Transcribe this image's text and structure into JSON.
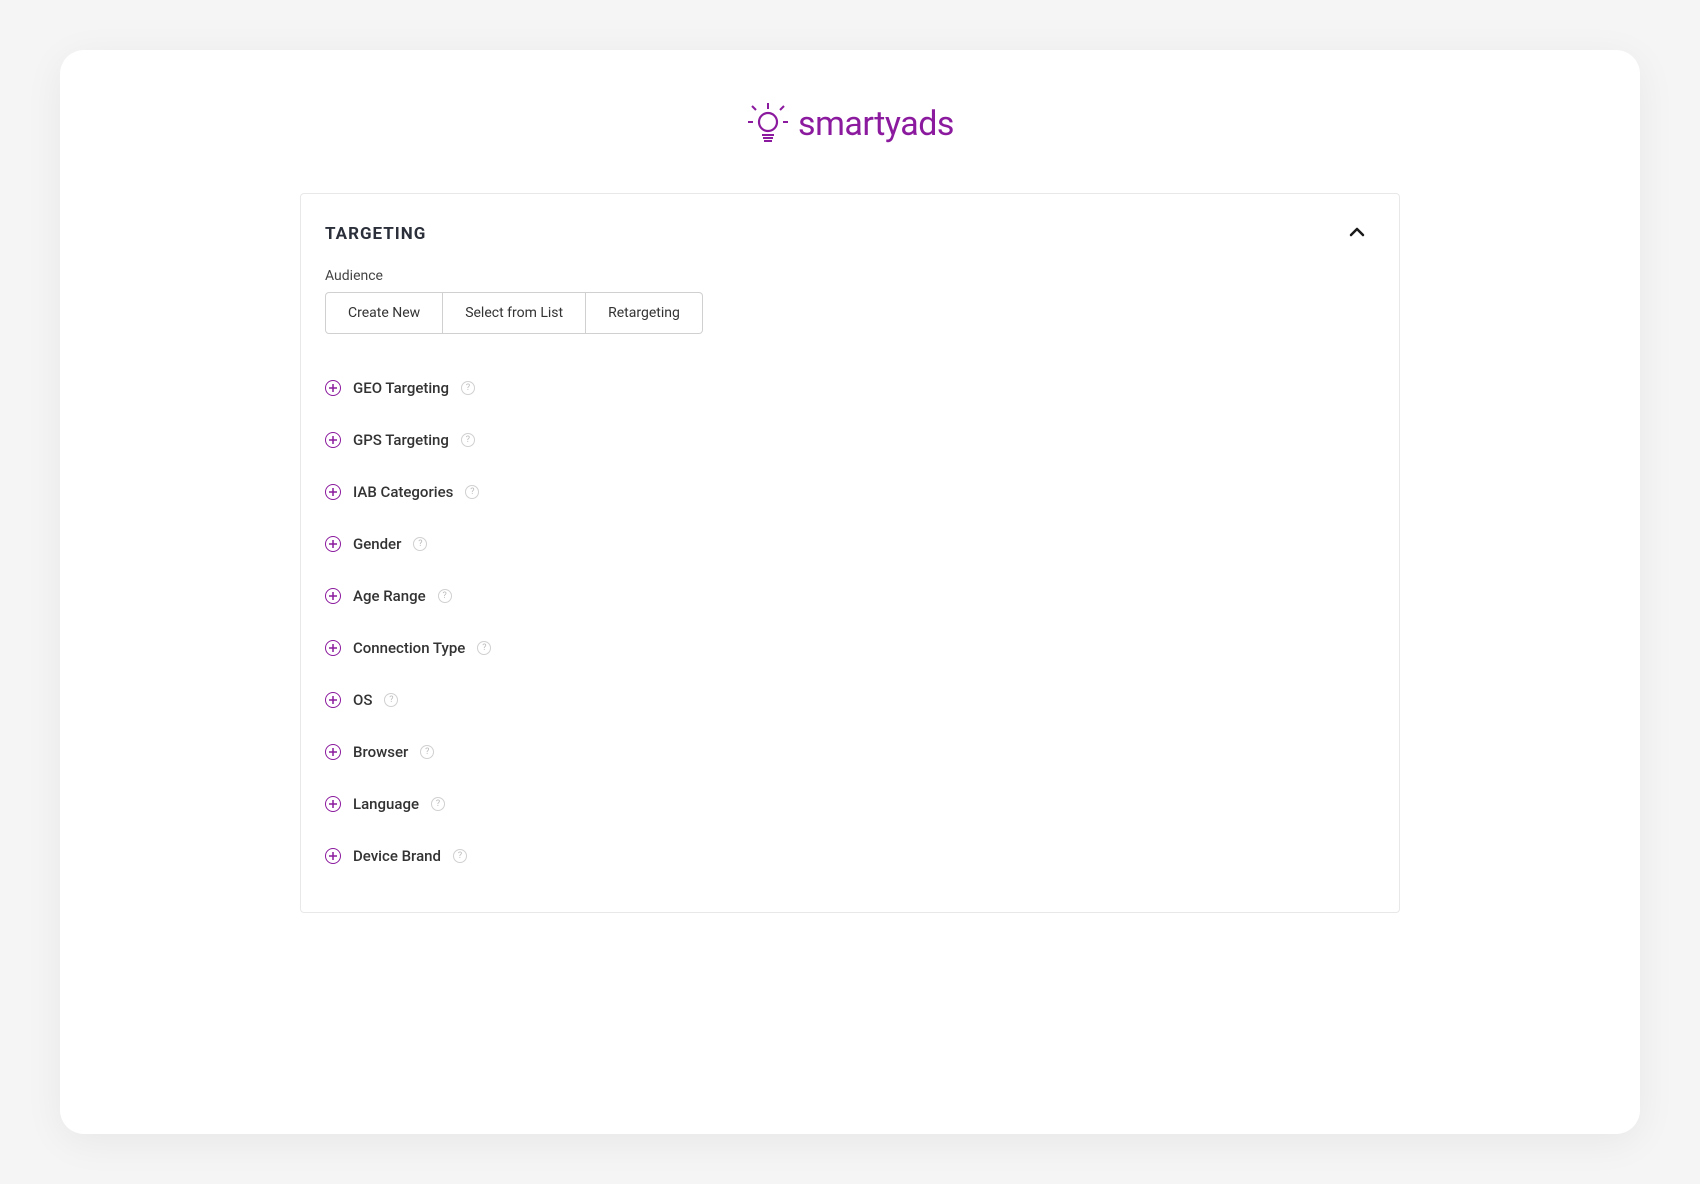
{
  "brand": {
    "name": "smartyads",
    "color": "#8b1a9e"
  },
  "panel": {
    "title": "TARGETING",
    "audience_label": "Audience",
    "buttons": {
      "create_new": "Create New",
      "select_from_list": "Select from List",
      "retargeting": "Retargeting"
    },
    "targeting_items": [
      {
        "label": "GEO Targeting"
      },
      {
        "label": "GPS Targeting"
      },
      {
        "label": "IAB Categories"
      },
      {
        "label": "Gender"
      },
      {
        "label": "Age Range"
      },
      {
        "label": "Connection Type"
      },
      {
        "label": "OS"
      },
      {
        "label": "Browser"
      },
      {
        "label": "Language"
      },
      {
        "label": "Device Brand"
      }
    ]
  }
}
